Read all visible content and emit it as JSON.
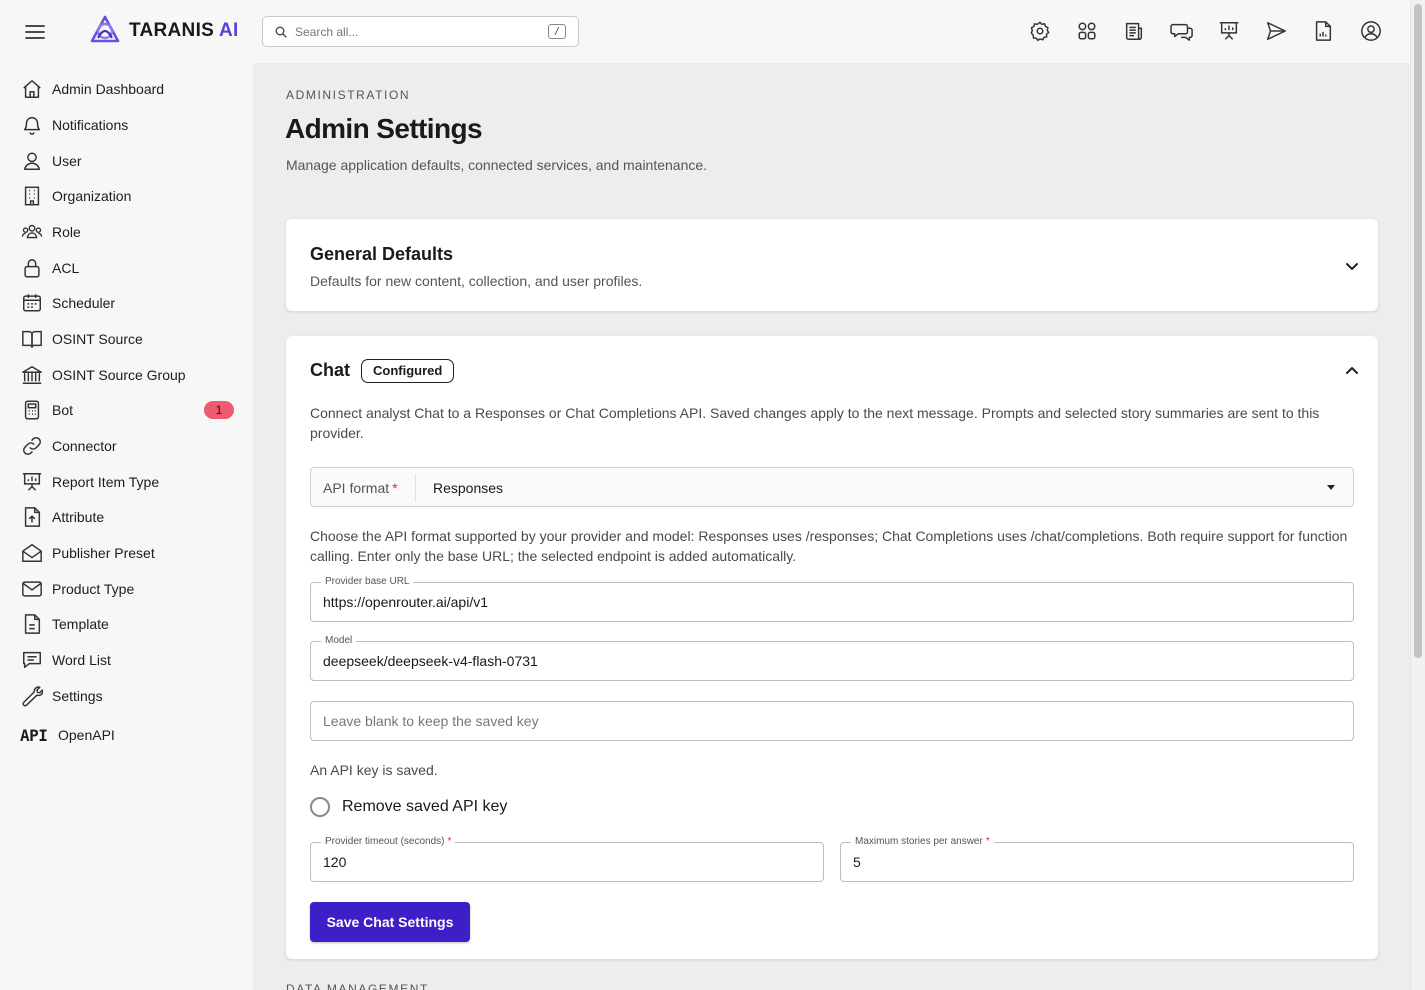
{
  "app": {
    "name_part1": "TARANIS",
    "name_part2": "AI",
    "brand_color": "#5b3fd6"
  },
  "search": {
    "placeholder": "Search all...",
    "shortcut": "/"
  },
  "top_icons": [
    "gear-icon",
    "dashboard-grid-icon",
    "newspaper-icon",
    "chat-bubbles-icon",
    "presentation-chart-icon",
    "send-icon",
    "document-chart-icon",
    "user-circle-icon"
  ],
  "sidebar": {
    "items": [
      {
        "label": "Admin Dashboard",
        "icon": "home-icon"
      },
      {
        "label": "Notifications",
        "icon": "bell-icon"
      },
      {
        "label": "User",
        "icon": "user-icon"
      },
      {
        "label": "Organization",
        "icon": "building-icon"
      },
      {
        "label": "Role",
        "icon": "users-group-icon"
      },
      {
        "label": "ACL",
        "icon": "lock-icon"
      },
      {
        "label": "Scheduler",
        "icon": "calendar-icon"
      },
      {
        "label": "OSINT Source",
        "icon": "book-open-icon"
      },
      {
        "label": "OSINT Source Group",
        "icon": "institution-icon"
      },
      {
        "label": "Bot",
        "icon": "calculator-icon",
        "badge": "1"
      },
      {
        "label": "Connector",
        "icon": "link-icon"
      },
      {
        "label": "Report Item Type",
        "icon": "presentation-chart-icon"
      },
      {
        "label": "Attribute",
        "icon": "file-upload-icon"
      },
      {
        "label": "Publisher Preset",
        "icon": "mail-open-icon"
      },
      {
        "label": "Product Type",
        "icon": "envelope-icon"
      },
      {
        "label": "Template",
        "icon": "file-text-icon"
      },
      {
        "label": "Word List",
        "icon": "message-text-icon"
      },
      {
        "label": "Settings",
        "icon": "wrench-icon"
      },
      {
        "label": "OpenAPI",
        "icon": "api-icon",
        "mark": "API"
      }
    ]
  },
  "header": {
    "eyebrow": "ADMINISTRATION",
    "title": "Admin Settings",
    "subtitle": "Manage application defaults, connected services, and maintenance."
  },
  "general_defaults": {
    "title": "General Defaults",
    "description": "Defaults for new content, collection, and user profiles."
  },
  "chat": {
    "title": "Chat",
    "status": "Configured",
    "description": "Connect analyst Chat to a Responses or Chat Completions API. Saved changes apply to the next message. Prompts and selected story summaries are sent to this provider.",
    "api_format_label": "API format",
    "api_format_required": "*",
    "api_format_value": "Responses",
    "format_help": "Choose the API format supported by your provider and model: Responses uses /responses; Chat Completions uses /chat/completions. Both require support for function calling. Enter only the base URL; the selected endpoint is added automatically.",
    "base_url_label": "Provider base URL",
    "base_url_value": "https://openrouter.ai/api/v1",
    "model_label": "Model",
    "model_value": "deepseek/deepseek-v4-flash-0731",
    "api_key_placeholder": "Leave blank to keep the saved key",
    "api_key_status": "An API key is saved.",
    "remove_key_label": "Remove saved API key",
    "timeout_label": "Provider timeout (seconds)",
    "timeout_required": "*",
    "timeout_value": "120",
    "max_stories_label": "Maximum stories per answer",
    "max_stories_required": "*",
    "max_stories_value": "5",
    "save_label": "Save Chat Settings",
    "save_color": "#3d1ec7"
  },
  "next_section": {
    "eyebrow": "DATA MANAGEMENT"
  }
}
